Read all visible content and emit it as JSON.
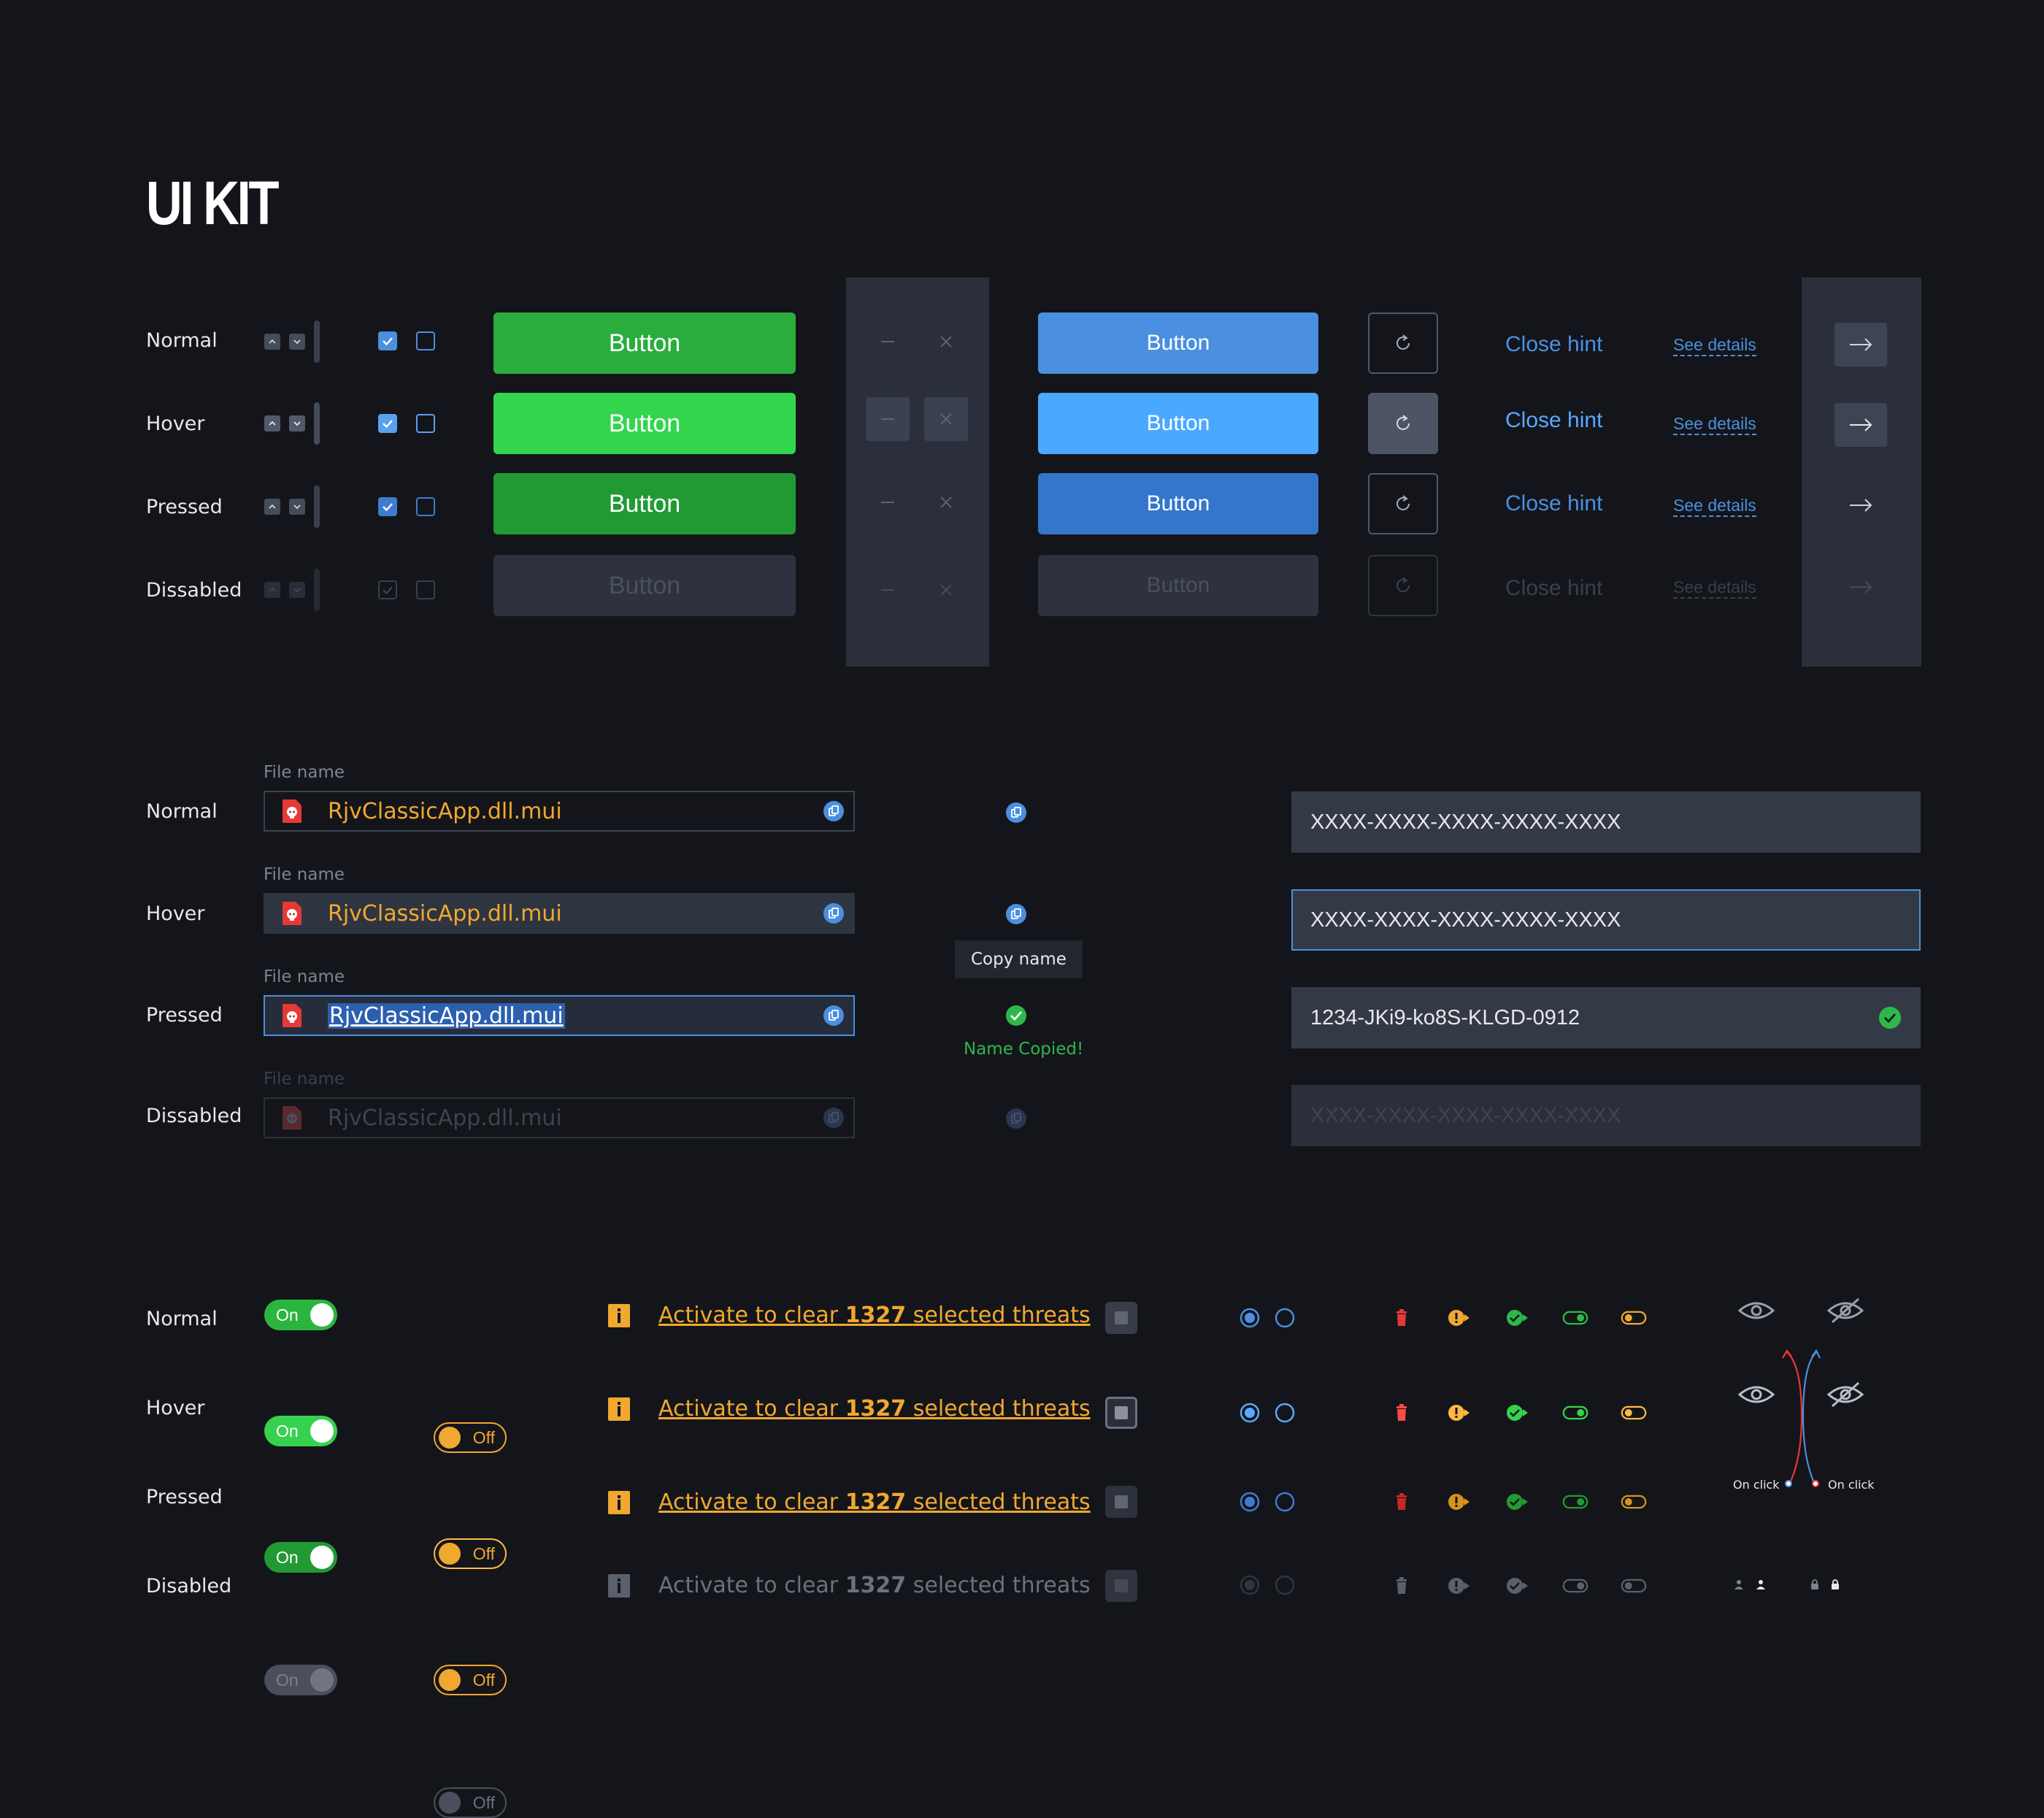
{
  "title": "UI KIT",
  "states": {
    "section1": [
      "Normal",
      "Hover",
      "Pressed",
      "Dissabled"
    ],
    "section2": [
      "Normal",
      "Hover",
      "Pressed",
      "Dissabled"
    ],
    "section3": [
      "Normal",
      "Hover",
      "Pressed",
      "Disabled"
    ]
  },
  "buttons": {
    "green_label": "Button",
    "blue_label": "Button"
  },
  "hint": {
    "close_label": "Close hint",
    "details_label": "See details"
  },
  "file_field": {
    "label": "File name",
    "value": "RjvClassicApp.dll.mui",
    "tooltip": "Copy name",
    "copied": "Name Copied!"
  },
  "key_field": {
    "placeholder": "XXXX-XXXX-XXXX-XXXX-XXXX",
    "entered_value": "1234-JKi9-ko8S-KLGD-0912"
  },
  "toggles": {
    "on_label": "On",
    "off_label": "Off"
  },
  "activate": {
    "prefix": "Activate to clear",
    "count": "1327",
    "suffix": "selected threats"
  },
  "eye_states": {
    "on_click_left": "On click",
    "on_click_right": "On click"
  },
  "colors": {
    "background": "#14151a",
    "green": "#2ab53e",
    "blue": "#4a90e2",
    "orange": "#f0a830",
    "red": "#e53935"
  },
  "icons": [
    "chevron-up-icon",
    "chevron-down-icon",
    "check-icon",
    "minimize-icon",
    "close-icon",
    "refresh-icon",
    "arrow-right-icon",
    "file-icon",
    "copy-icon",
    "check-circle-icon",
    "info-icon",
    "stop-icon",
    "radio-icon",
    "trash-icon",
    "warning-arrow-icon",
    "check-arrow-icon",
    "toggle-icon",
    "eye-icon",
    "eye-off-icon",
    "user-icon",
    "lock-icon"
  ]
}
